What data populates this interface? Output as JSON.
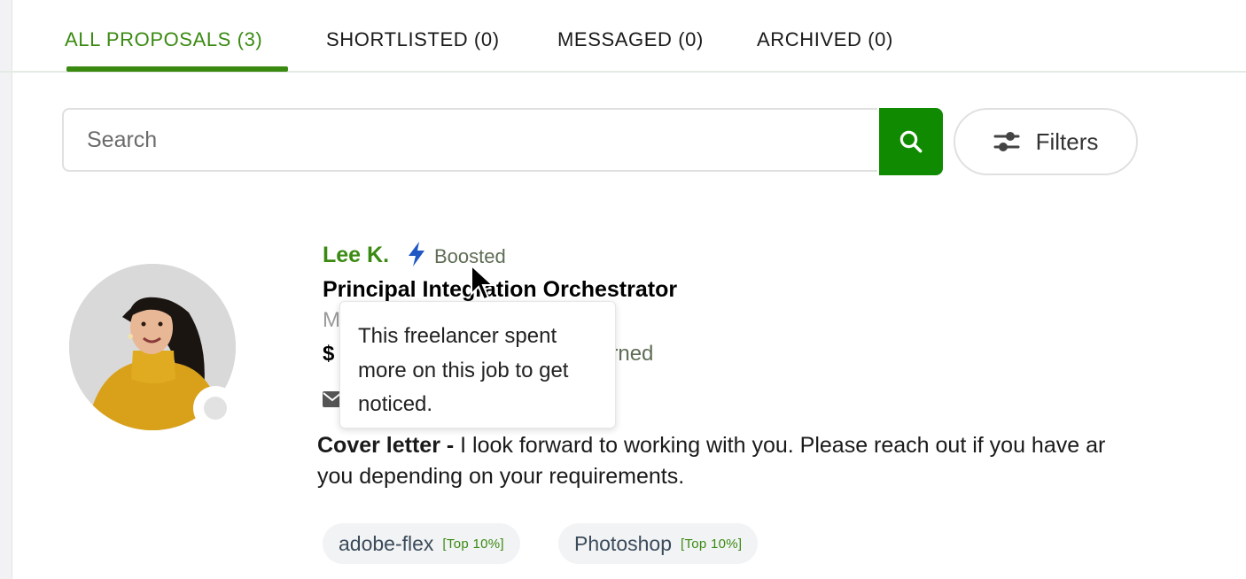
{
  "tabs": [
    {
      "label": "ALL PROPOSALS (3)",
      "active": true
    },
    {
      "label": "SHORTLISTED (0)"
    },
    {
      "label": "MESSAGED (0)"
    },
    {
      "label": "ARCHIVED (0)"
    }
  ],
  "search": {
    "placeholder": "Search",
    "value": "",
    "button_icon": "search-icon"
  },
  "filters": {
    "label": "Filters",
    "icon": "sliders-icon"
  },
  "proposal": {
    "name": "Lee K.",
    "boost_icon": "lightning-bolt-icon",
    "boosted_label": "Boosted",
    "title": "Principal Integration Orchestrator",
    "title_visible": "Principal Int     ration Orchestrator",
    "location_partial": "M",
    "rate_partial": "$",
    "earned_partial": "arned",
    "message_icon": "envelope-icon",
    "tooltip": "This freelancer spent more on this job to get noticed.",
    "cover_label": "Cover letter -",
    "cover_text_line1": " I look forward to working with you. Please reach out if you have ar",
    "cover_text_line2": "you depending on your requirements.",
    "skills": [
      {
        "name": "adobe-flex",
        "badge": "[Top 10%]"
      },
      {
        "name": "Photoshop",
        "badge": "[Top 10%]"
      }
    ]
  },
  "colors": {
    "brand_green": "#108a00",
    "link_green": "#3a8a12",
    "boost_blue": "#1f57c3"
  }
}
